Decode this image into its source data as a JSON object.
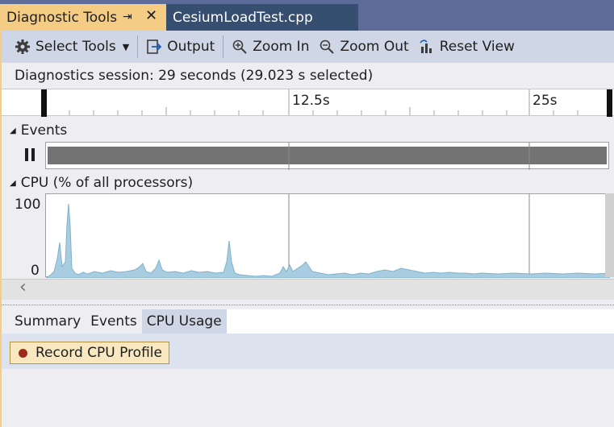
{
  "tabs": {
    "active_label": "Diagnostic Tools",
    "inactive_label": "CesiumLoadTest.cpp"
  },
  "toolbar": {
    "select_tools_label": "Select Tools",
    "output_label": "Output",
    "zoom_in_label": "Zoom In",
    "zoom_out_label": "Zoom Out",
    "reset_view_label": "Reset View"
  },
  "session": {
    "text": "Diagnostics session: 29 seconds (29.023 s selected)"
  },
  "ruler": {
    "labels": [
      "12.5s",
      "25s"
    ]
  },
  "events": {
    "title": "Events"
  },
  "cpu": {
    "title": "CPU (% of all processors)",
    "y_max_label": "100",
    "y_min_label": "0"
  },
  "bottom_tabs": [
    "Summary",
    "Events",
    "CPU Usage"
  ],
  "record_button": {
    "label": "Record CPU Profile"
  },
  "colors": {
    "accent_tab": "#f5cc84",
    "cpu_fill": "#a8cde0",
    "record_dot": "#a3281c"
  }
}
